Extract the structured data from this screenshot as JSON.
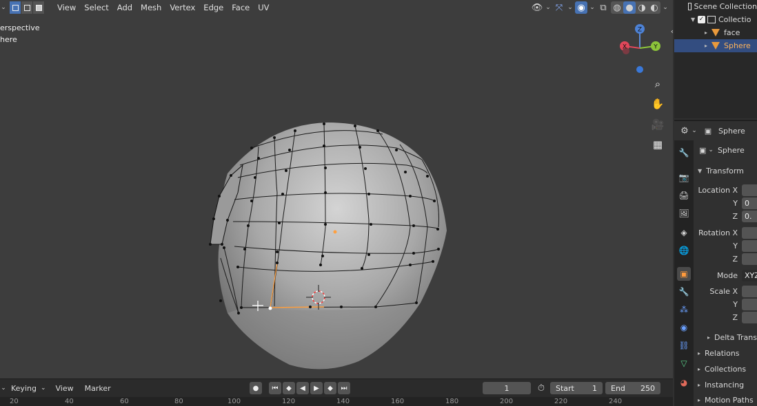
{
  "viewport": {
    "menus": [
      "View",
      "Select",
      "Add",
      "Mesh",
      "Vertex",
      "Edge",
      "Face",
      "UV"
    ],
    "overlay_line1": "erspective",
    "overlay_line2": "here",
    "gizmo": {
      "z": "Z",
      "x": "X",
      "y": "Y"
    }
  },
  "outliner": {
    "rows": [
      {
        "label": "Scene Collection"
      },
      {
        "label": "Collectio"
      },
      {
        "label": "face"
      },
      {
        "label": "Sphere"
      }
    ]
  },
  "properties": {
    "header_object": "Sphere",
    "data_name": "Sphere",
    "transform_label": "Transform",
    "location_x": "Location X",
    "loc_x_val": "",
    "loc_y_val": "0",
    "loc_z_val": "0.",
    "rotation_x": "Rotation X",
    "mode_label": "Mode",
    "mode_val": "XYZ",
    "scale_x": "Scale X",
    "y": "Y",
    "z": "Z",
    "delta": "Delta Transfo",
    "relations": "Relations",
    "collections": "Collections",
    "instancing": "Instancing",
    "motion_paths": "Motion Paths"
  },
  "timeline": {
    "keying": "Keying",
    "view": "View",
    "marker": "Marker",
    "current_frame": "1",
    "start_label": "Start",
    "start_val": "1",
    "end_label": "End",
    "end_val": "250",
    "ruler": [
      "20",
      "40",
      "60",
      "80",
      "100",
      "120",
      "140",
      "160",
      "180",
      "200",
      "220",
      "240"
    ]
  },
  "colors": {
    "accent": "#4772b3",
    "selected_orange": "#ffa040",
    "viewport_bg": "#3d3d3d"
  }
}
